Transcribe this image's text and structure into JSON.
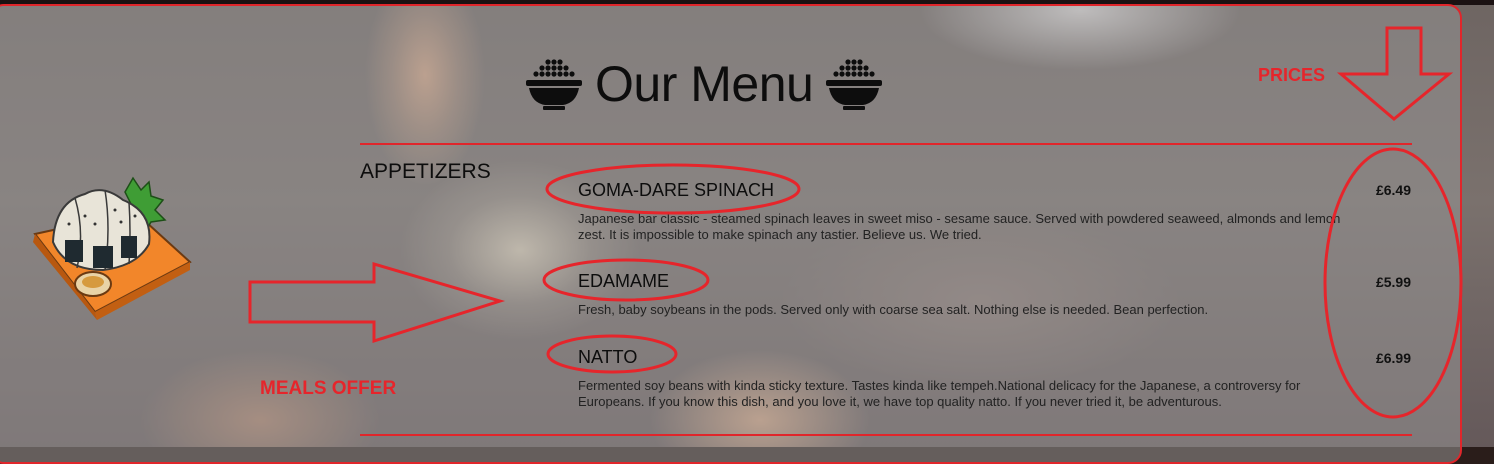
{
  "menu": {
    "title": "Our Menu",
    "category": "APPETIZERS",
    "items": [
      {
        "name": "GOMA-DARE SPINACH",
        "price": "£6.49",
        "description_line1": "Japanese bar classic - steamed spinach leaves in sweet miso - sesame sauce. Served with powdered seaweed, almonds and lemon",
        "description_line2": "zest. It is impossible to make spinach any tastier. Believe us. We tried."
      },
      {
        "name": "EDAMAME",
        "price": "£5.99",
        "description_line1": "Fresh, baby soybeans in the pods. Served only with coarse sea salt. Nothing else is needed. Bean perfection.",
        "description_line2": ""
      },
      {
        "name": "NATTO",
        "price": "£6.99",
        "description_line1": "Fermented soy beans with kinda sticky texture. Tastes kinda like tempeh.National delicacy for the Japanese, a controversy for",
        "description_line2": "Europeans. If you know this dish, and you love it, we have top quality natto. If you never tried it, be adventurous."
      }
    ]
  },
  "annotations": {
    "prices_label": "PRICES",
    "meals_label": "MEALS OFFER",
    "color": "#e6252b"
  },
  "icons": {
    "title_icon": "rice-bowl-icon",
    "illustration": "onigiri-plate-illustration"
  }
}
